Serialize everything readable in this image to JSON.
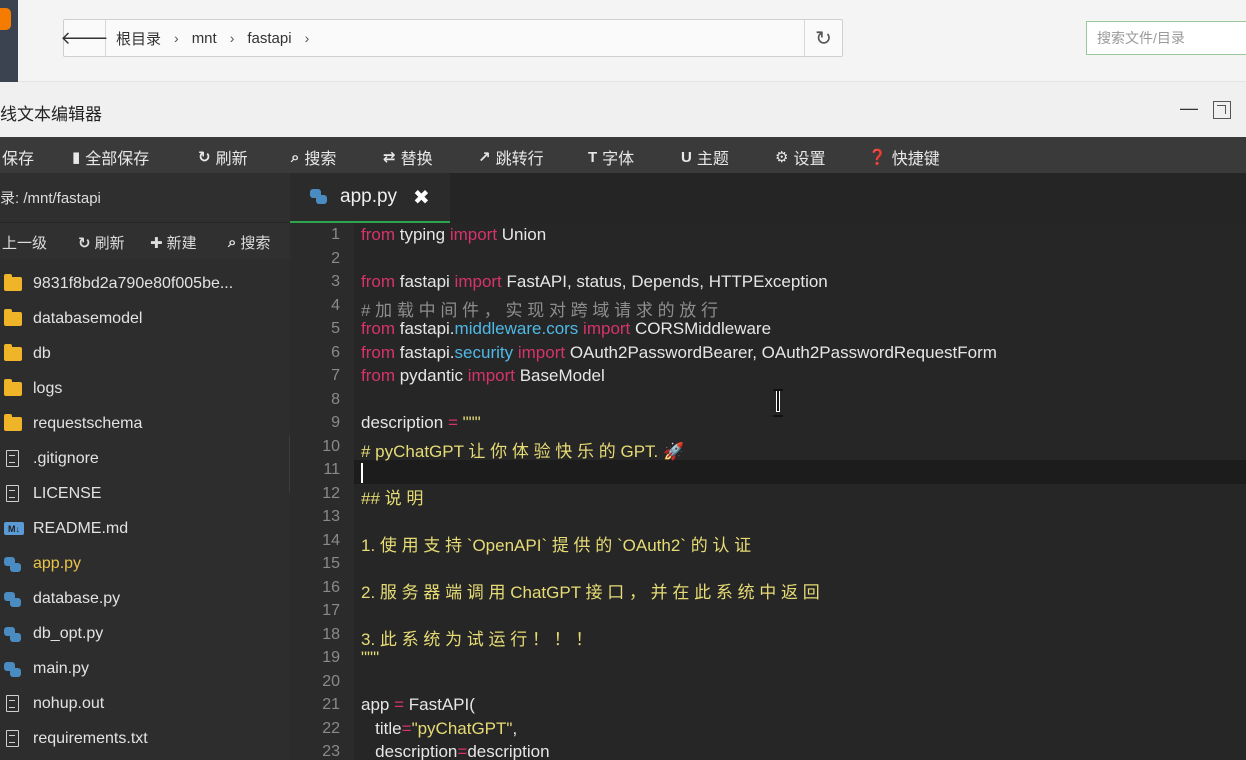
{
  "topbar": {
    "breadcrumbs": [
      "根目录",
      "mnt",
      "fastapi"
    ],
    "search_placeholder": "搜索文件/目录"
  },
  "window": {
    "title": "线文本编辑器"
  },
  "toolbar": {
    "items": [
      {
        "icon": "save-icon",
        "label": "保存"
      },
      {
        "icon": "save-all-icon",
        "label": "全部保存"
      },
      {
        "icon": "refresh-icon",
        "label": "刷新"
      },
      {
        "icon": "search-icon",
        "label": "搜索"
      },
      {
        "icon": "replace-icon",
        "label": "替换"
      },
      {
        "icon": "goto-line-icon",
        "label": "跳转行"
      },
      {
        "icon": "font-icon",
        "label": "字体"
      },
      {
        "icon": "theme-icon",
        "label": "主题"
      },
      {
        "icon": "gear-icon",
        "label": "设置"
      },
      {
        "icon": "help-icon",
        "label": "快捷键"
      }
    ]
  },
  "sidebar": {
    "path": "录: /mnt/fastapi",
    "actions": [
      {
        "label": "上一级"
      },
      {
        "icon": "refresh-icon",
        "label": "刷新"
      },
      {
        "icon": "plus-icon",
        "label": "新建"
      },
      {
        "icon": "search-icon",
        "label": "搜索"
      }
    ],
    "files": [
      {
        "type": "folder",
        "name": "9831f8bd2a790e80f005be..."
      },
      {
        "type": "folder",
        "name": "databasemodel"
      },
      {
        "type": "folder",
        "name": "db"
      },
      {
        "type": "folder",
        "name": "logs"
      },
      {
        "type": "folder",
        "name": "requestschema"
      },
      {
        "type": "file",
        "name": ".gitignore"
      },
      {
        "type": "file",
        "name": "LICENSE"
      },
      {
        "type": "markdown",
        "name": "README.md"
      },
      {
        "type": "python",
        "name": "app.py",
        "active": true
      },
      {
        "type": "python",
        "name": "database.py"
      },
      {
        "type": "python",
        "name": "db_opt.py"
      },
      {
        "type": "python",
        "name": "main.py"
      },
      {
        "type": "file",
        "name": "nohup.out"
      },
      {
        "type": "file",
        "name": "requirements.txt"
      }
    ]
  },
  "tabs": [
    {
      "name": "app.py",
      "icon": "python-icon"
    }
  ],
  "editor": {
    "current_line": 11,
    "lines": [
      [
        [
          "kw",
          "from"
        ],
        [
          "t",
          " typing "
        ],
        [
          "kw",
          "import"
        ],
        [
          "t",
          " Union"
        ]
      ],
      [],
      [
        [
          "kw",
          "from"
        ],
        [
          "t",
          " fastapi "
        ],
        [
          "kw",
          "import"
        ],
        [
          "t",
          " FastAPI, status, Depends, HTTPException"
        ]
      ],
      [
        [
          "cm",
          "# 加 载 中 间 件 ， 实 现 对 跨 域 请 求 的 放 行"
        ]
      ],
      [
        [
          "kw",
          "from"
        ],
        [
          "t",
          " fastapi."
        ],
        [
          "mod",
          "middleware.cors"
        ],
        [
          "t",
          " "
        ],
        [
          "kw",
          "import"
        ],
        [
          "t",
          " CORSMiddleware"
        ]
      ],
      [
        [
          "kw",
          "from"
        ],
        [
          "t",
          " fastapi."
        ],
        [
          "mod",
          "security"
        ],
        [
          "t",
          " "
        ],
        [
          "kw",
          "import"
        ],
        [
          "t",
          " OAuth2PasswordBearer, OAuth2PasswordRequestForm"
        ]
      ],
      [
        [
          "kw",
          "from"
        ],
        [
          "t",
          " pydantic "
        ],
        [
          "kw",
          "import"
        ],
        [
          "t",
          " BaseModel"
        ]
      ],
      [],
      [
        [
          "t",
          "description "
        ],
        [
          "op",
          "="
        ],
        [
          "t",
          " "
        ],
        [
          "str",
          "\"\"\""
        ]
      ],
      [
        [
          "hd",
          "# pyChatGPT 让 你 体 验 快 乐 的 GPT. 🚀"
        ]
      ],
      [],
      [
        [
          "hd",
          "## 说 明"
        ]
      ],
      [],
      [
        [
          "hd",
          "1. 使 用 支 持 `OpenAPI` 提 供 的 `OAuth2` 的 认 证"
        ]
      ],
      [],
      [
        [
          "hd",
          "2. 服 务 器 端 调 用 ChatGPT 接 口 ， 并 在 此 系 统 中 返 回"
        ]
      ],
      [],
      [
        [
          "hd",
          "3. 此 系 统 为 试 运 行 ！ ！ ！"
        ]
      ],
      [
        [
          "str",
          "\"\"\""
        ]
      ],
      [],
      [
        [
          "t",
          "app "
        ],
        [
          "op",
          "="
        ],
        [
          "t",
          " FastAPI("
        ]
      ],
      [
        [
          "t",
          "   title"
        ],
        [
          "op",
          "="
        ],
        [
          "str",
          "\"pyChatGPT\""
        ],
        [
          "t",
          ","
        ]
      ],
      [
        [
          "t",
          "   description"
        ],
        [
          "op",
          "="
        ],
        [
          "t",
          "description"
        ]
      ]
    ]
  }
}
